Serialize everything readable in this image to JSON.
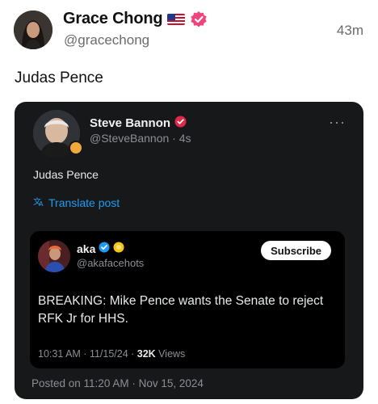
{
  "post": {
    "author_name": "Grace Chong",
    "handle": "@gracechong",
    "time": "43m",
    "text": "Judas Pence"
  },
  "embed": {
    "author_name": "Steve Bannon",
    "handle_time": "@SteveBannon · 4s",
    "text": "Judas Pence",
    "translate_label": "Translate post",
    "more_label": "···",
    "quote": {
      "author_name": "aka",
      "handle": "@akafacehots",
      "subscribe_label": "Subscribe",
      "text": "BREAKING: Mike Pence wants the Senate to reject RFK Jr for HHS.",
      "meta_time": "10:31 AM · 11/15/24 · ",
      "views_count": "32K",
      "views_label": " Views"
    },
    "posted_on": "Posted on 11:20 AM · Nov 15, 2024"
  },
  "colors": {
    "verified_pink": "#f0457c",
    "verified_red": "#e0294a",
    "link_blue": "#1d9bf0",
    "card_bg": "#17181a",
    "gold": "#f5c518"
  },
  "icons": {
    "flag": "us-flag-icon",
    "verified": "verified-badge-icon",
    "translate": "translate-icon",
    "more": "more-options-icon"
  }
}
